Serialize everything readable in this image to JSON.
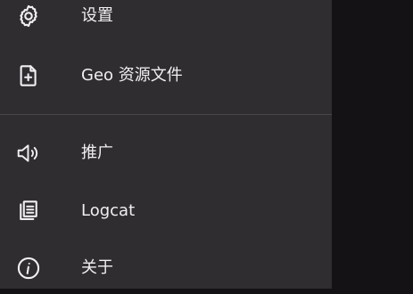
{
  "drawer": {
    "items": [
      {
        "label": "设置",
        "icon": "gear-icon"
      },
      {
        "label": "Geo 资源文件",
        "icon": "file-add-icon"
      },
      {
        "label": "推广",
        "icon": "megaphone-icon"
      },
      {
        "label": "Logcat",
        "icon": "copy-icon"
      },
      {
        "label": "关于",
        "icon": "info-icon"
      }
    ]
  },
  "colors": {
    "drawer_bg": "#2f2d30",
    "scrim_bg": "#141215",
    "text": "#f1eff2",
    "divider": "#4a474b"
  }
}
